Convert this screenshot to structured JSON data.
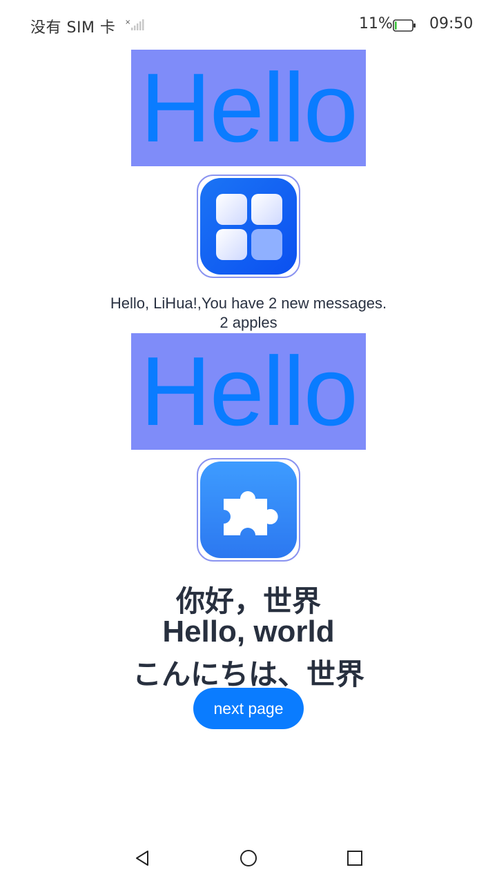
{
  "status_bar": {
    "carrier": "没有 SIM 卡",
    "battery_percent": "11%",
    "time": "09:50",
    "battery_level": 0.11,
    "battery_color": "#3cc03c"
  },
  "hello_boxes": [
    {
      "text": "Hello"
    },
    {
      "text": "Hello"
    }
  ],
  "icons": [
    {
      "name": "app-grid-icon"
    },
    {
      "name": "puzzle-piece-icon"
    }
  ],
  "messages": {
    "line1": "Hello, LiHua!,You have 2 new messages.",
    "line2": "2 apples"
  },
  "greetings": {
    "chinese": "你好，世界",
    "english": "Hello, world",
    "japanese": "こんにちは、世界"
  },
  "button": {
    "label": "next page"
  },
  "nav": {
    "back_icon": "back-triangle-icon",
    "home_icon": "home-circle-icon",
    "recent_icon": "recent-square-icon"
  },
  "colors": {
    "accent": "#0a7cff",
    "hello_background": "#7f8cf9",
    "text_dark": "#28303f"
  }
}
